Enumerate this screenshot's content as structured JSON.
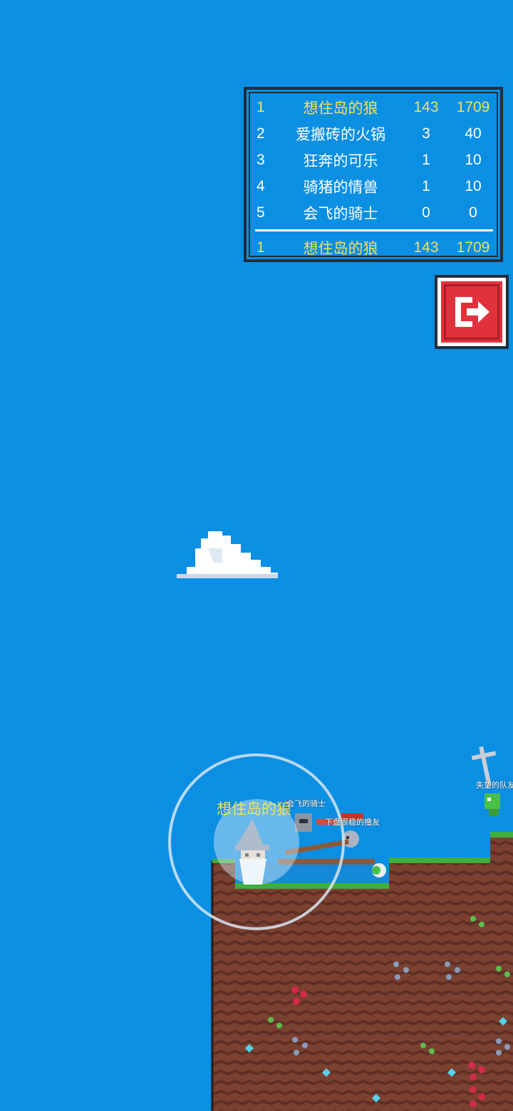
{
  "leaderboard": {
    "rows": [
      {
        "rank": "1",
        "name": "想住岛的狼",
        "kills": "143",
        "score": "1709",
        "highlight": true
      },
      {
        "rank": "2",
        "name": "爱搬砖的火锅",
        "kills": "3",
        "score": "40",
        "highlight": false
      },
      {
        "rank": "3",
        "name": "狂奔的可乐",
        "kills": "1",
        "score": "10",
        "highlight": false
      },
      {
        "rank": "4",
        "name": "骑猪的情兽",
        "kills": "1",
        "score": "10",
        "highlight": false
      },
      {
        "rank": "5",
        "name": "会飞的骑士",
        "kills": "0",
        "score": "0",
        "highlight": false
      }
    ],
    "self": {
      "rank": "1",
      "name": "想住岛的狼",
      "kills": "143",
      "score": "1709"
    }
  },
  "exit_button": {
    "icon": "exit-icon"
  },
  "players": {
    "me": "想住岛的狼",
    "knight": "会飞的骑士",
    "teammate": "下盘很稳的撸友",
    "far": "失望的队友"
  },
  "colors": {
    "sky": "#0b8fe3",
    "highlight": "#f3e25a",
    "dirt": "#7a4030",
    "grass": "#3fae3f",
    "exit_red": "#e0323c"
  }
}
